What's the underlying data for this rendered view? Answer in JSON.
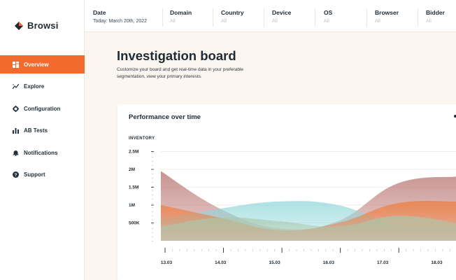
{
  "app": {
    "name": "Browsi"
  },
  "sidebar": {
    "items": [
      {
        "label": "Overview",
        "icon": "dashboard-icon",
        "active": true
      },
      {
        "label": "Explore",
        "icon": "trend-icon",
        "active": false
      },
      {
        "label": "Configuration",
        "icon": "gear-icon",
        "active": false
      },
      {
        "label": "AB Tests",
        "icon": "bar-chart-icon",
        "active": false
      },
      {
        "label": "Notifications",
        "icon": "bell-icon",
        "active": false
      },
      {
        "label": "Support",
        "icon": "help-icon",
        "active": false
      }
    ]
  },
  "filters": [
    {
      "label": "Date",
      "value": "Today: March 20th, 2022"
    },
    {
      "label": "Domain",
      "value": "All"
    },
    {
      "label": "Country",
      "value": "All"
    },
    {
      "label": "Device",
      "value": "All"
    },
    {
      "label": "OS",
      "value": "All"
    },
    {
      "label": "Browser",
      "value": "All"
    },
    {
      "label": "Bidder",
      "value": "All"
    }
  ],
  "main": {
    "title": "Investigation board",
    "subtitle": "Customize your board and get real-time data in your preferable segmentation, view your primary interests."
  },
  "colors": {
    "accent": "#f26a2e",
    "series_red": "#b36a66",
    "series_cyan": "#8fd6da",
    "series_orange": "#f07a3a",
    "series_sage": "#a9c9ad"
  },
  "chart_data": {
    "type": "area",
    "title": "Performance over time",
    "ylabel": "INVENTORY",
    "xlabel": "",
    "categories": [
      "13.03",
      "14.03",
      "15.03",
      "16.03",
      "17.03",
      "18.03"
    ],
    "y_ticks": [
      "2.5M",
      "2M",
      "1.5M",
      "1M",
      "500K"
    ],
    "ylim": [
      0,
      2500000
    ],
    "grid": true,
    "legend": "none",
    "series": [
      {
        "values": [
          1950000,
          900000,
          350000,
          550000,
          1600000,
          1800000
        ],
        "color": "#b36a66"
      },
      {
        "values": [
          600000,
          900000,
          1100000,
          1000000,
          450000,
          400000
        ],
        "color": "#8fd6da"
      },
      {
        "values": [
          1000000,
          650000,
          300000,
          500000,
          1050000,
          1100000
        ],
        "color": "#f07a3a"
      },
      {
        "values": [
          400000,
          650000,
          550000,
          400000,
          700000,
          500000
        ],
        "color": "#a9c9ad"
      }
    ]
  }
}
